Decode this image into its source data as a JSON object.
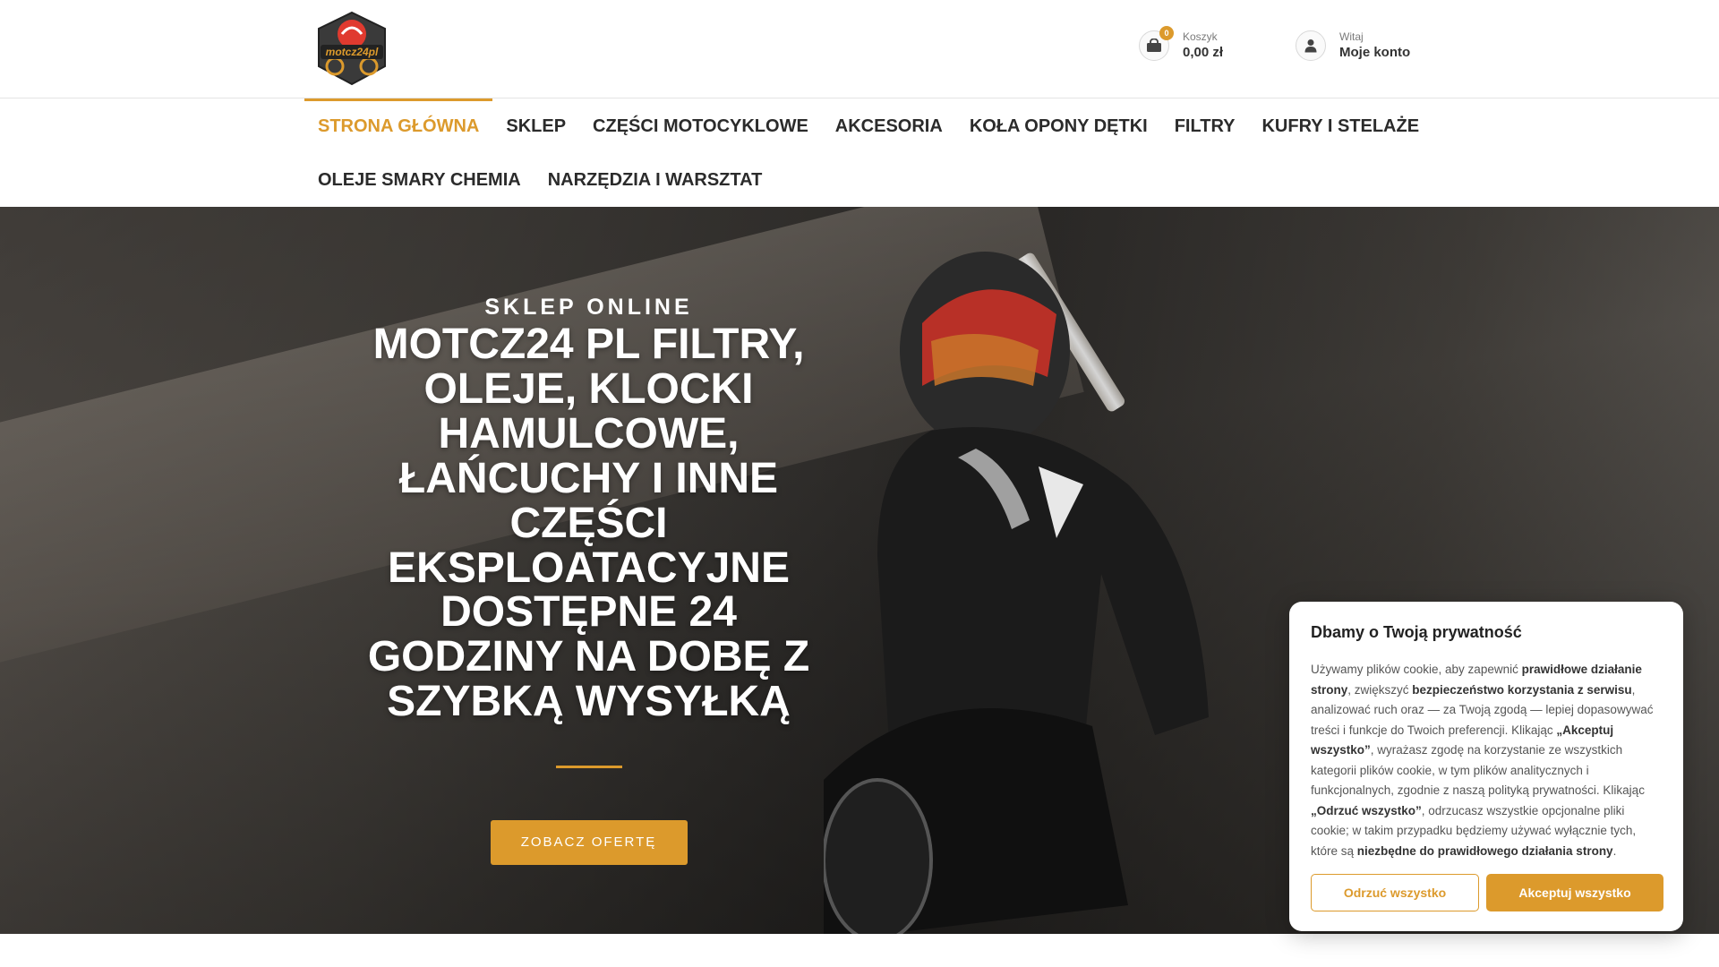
{
  "header": {
    "logo_text": "motcz24pl",
    "cart": {
      "count": "0",
      "label": "Koszyk",
      "total": "0,00 zł"
    },
    "account": {
      "greeting": "Witaj",
      "label": "Moje konto"
    }
  },
  "nav": {
    "row1": [
      {
        "label": "STRONA GŁÓWNA",
        "active": true
      },
      {
        "label": "SKLEP"
      },
      {
        "label": "CZĘŚCI MOTOCYKLOWE"
      },
      {
        "label": "AKCESORIA"
      },
      {
        "label": "KOŁA OPONY DĘTKI"
      },
      {
        "label": "FILTRY"
      },
      {
        "label": "KUFRY I STELAŻE"
      }
    ],
    "row2": [
      {
        "label": "OLEJE SMARY CHEMIA"
      },
      {
        "label": "NARZĘDZIA I WARSZTAT"
      }
    ]
  },
  "hero": {
    "pretitle": "SKLEP ONLINE",
    "title": "MOTCZ24 PL FILTRY, OLEJE, KLOCKI HAMULCOWE, ŁAŃCUCHY I INNE CZĘŚCI EKSPLOATACYJNE DOSTĘPNE 24 GODZINY NA DOBĘ Z SZYBKĄ WYSYŁKĄ",
    "button": "ZOBACZ OFERTĘ"
  },
  "cookie": {
    "title": "Dbamy o Twoją prywatność",
    "text_parts": [
      {
        "t": "Używamy plików cookie, aby zapewnić "
      },
      {
        "t": "prawidłowe działanie strony",
        "b": true
      },
      {
        "t": ", zwiększyć "
      },
      {
        "t": "bezpieczeństwo korzystania z serwisu",
        "b": true
      },
      {
        "t": ", analizować ruch oraz — za Twoją zgodą — lepiej dopasowywać treści i funkcje do Twoich preferencji. Klikając "
      },
      {
        "t": "„Akceptuj wszystko”",
        "b": true
      },
      {
        "t": ", wyrażasz zgodę na korzystanie ze wszystkich kategorii plików cookie, w tym plików analitycznych i funkcjonalnych, zgodnie z naszą polityką prywatności. Klikając "
      },
      {
        "t": "„Odrzuć wszystko”",
        "b": true
      },
      {
        "t": ", odrzucasz wszystkie opcjonalne pliki cookie; w takim przypadku będziemy używać wyłącznie tych, które są "
      },
      {
        "t": "niezbędne do prawidłowego działania strony",
        "b": true
      },
      {
        "t": "."
      }
    ],
    "reject_label": "Odrzuć wszystko",
    "accept_label": "Akceptuj wszystko"
  },
  "colors": {
    "accent": "#dc9a2c",
    "text": "#2b2b2b"
  }
}
